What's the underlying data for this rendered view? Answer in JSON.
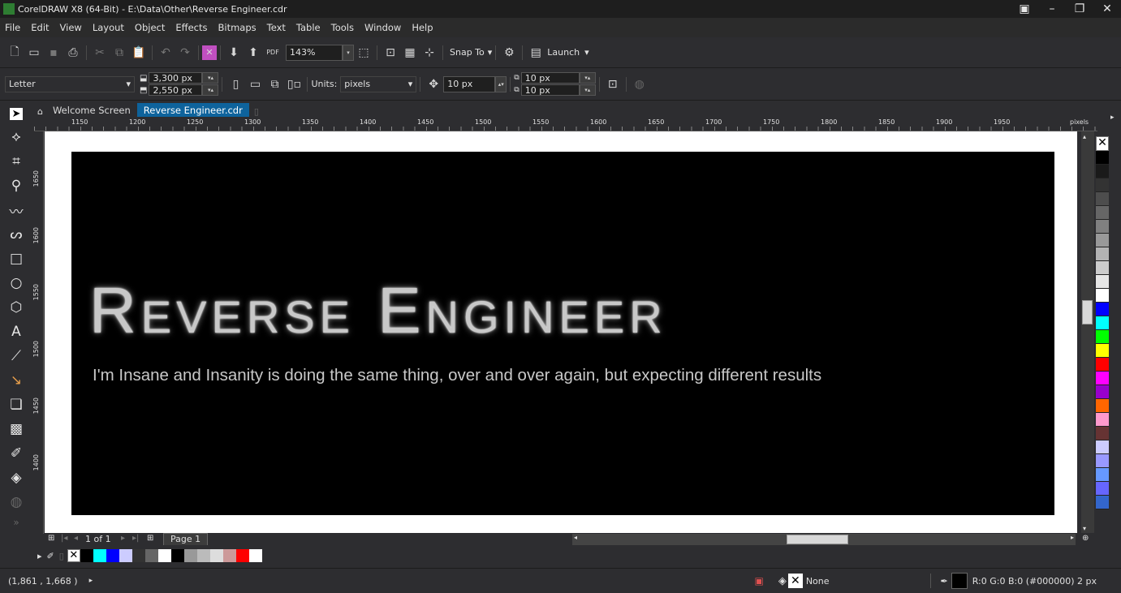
{
  "window": {
    "title": "CorelDRAW X8 (64-Bit) - E:\\Data\\Other\\Reverse Engineer.cdr"
  },
  "menu": [
    "File",
    "Edit",
    "View",
    "Layout",
    "Object",
    "Effects",
    "Bitmaps",
    "Text",
    "Table",
    "Tools",
    "Window",
    "Help"
  ],
  "toolbar": {
    "zoom": "143%",
    "snap_label": "Snap To",
    "launch_label": "Launch"
  },
  "property_bar": {
    "page_size": "Letter",
    "width": "3,300 px",
    "height": "2,550 px",
    "units_label": "Units:",
    "units": "pixels",
    "nudge": "10 px",
    "dup_x": "10 px",
    "dup_y": "10 px"
  },
  "tabs": [
    {
      "label": "Welcome Screen"
    },
    {
      "label": "Reverse Engineer.cdr"
    }
  ],
  "ruler": {
    "h_ticks": [
      "1150",
      "1200",
      "1250",
      "1300",
      "1350",
      "1400",
      "1450",
      "1500",
      "1550",
      "1600",
      "1650",
      "1700",
      "1750",
      "1800",
      "1850",
      "1900",
      "1950"
    ],
    "unit": "pixels",
    "v_ticks": [
      "1650",
      "1600",
      "1550",
      "1500",
      "1450",
      "1400"
    ]
  },
  "artwork": {
    "title": "Reverse Engineer",
    "tagline": "I'm Insane and Insanity is doing the same thing, over and over again, but expecting different results"
  },
  "page_nav": {
    "page_info": "1 of 1",
    "page_tab": "Page 1"
  },
  "status": {
    "coords": "(1,861 , 1,668 )",
    "fill": "None",
    "outline": "R:0 G:0 B:0 (#000000)  2 px"
  },
  "palette_colors": [
    "#000000",
    "#1a1a1a",
    "#333333",
    "#4d4d4d",
    "#666666",
    "#808080",
    "#999999",
    "#b3b3b3",
    "#cccccc",
    "#e6e6e6",
    "#ffffff",
    "#0000ff",
    "#00ffff",
    "#00ff00",
    "#ffff00",
    "#ff0000",
    "#ff00ff",
    "#9900cc",
    "#ff6600",
    "#ff99cc",
    "#663333",
    "#ccccff",
    "#9999ff",
    "#6699ff",
    "#6666ff",
    "#3366cc"
  ],
  "doc_palette": [
    "#00ffff",
    "#0000ff",
    "#ccccff",
    "#333333",
    "#666666",
    "#ffffff",
    "#000000",
    "#999999",
    "#bbbbbb",
    "#dddddd",
    "#cc9999",
    "#ff0000",
    "#ffffff"
  ]
}
